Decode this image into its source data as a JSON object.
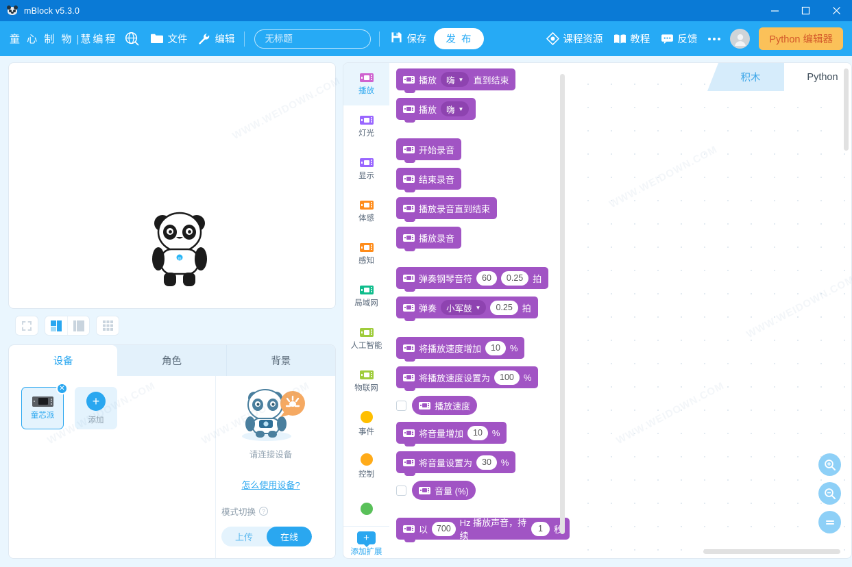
{
  "window": {
    "app_title": "mBlock v5.3.0",
    "minimize": "—",
    "maximize": "□",
    "close": "✕"
  },
  "menubar": {
    "brand": "童 心 制 物",
    "brand_sep": "|",
    "brand2": "慧编程",
    "globe_icon": "globe-icon",
    "file_label": "文件",
    "file_icon": "folder-icon",
    "edit_label": "编辑",
    "edit_icon": "wrench-icon",
    "project_name_value": "无标题",
    "project_name_placeholder": "无标题",
    "save_label": "保存",
    "save_icon": "floppy-disk-icon",
    "publish_label": "发 布",
    "courses_label": "课程资源",
    "courses_icon": "diamond-play-icon",
    "tutorial_label": "教程",
    "tutorial_icon": "book-icon",
    "feedback_label": "反馈",
    "feedback_icon": "chat-icon",
    "more_icon": "ellipsis-icon",
    "avatar_icon": "user-avatar-icon",
    "python_label": "Python 编辑器"
  },
  "stage": {
    "sprite_name": "panda-sprite",
    "tools": {
      "fullscreen_icon": "fullscreen-icon",
      "layout_small_icon": "layout-small-icon",
      "layout_large_icon": "layout-large-icon",
      "grid_icon": "grid-icon",
      "stop_icon": "stop-icon",
      "start_icon": "green-flag-icon"
    }
  },
  "bottom_panel": {
    "tabs": [
      {
        "label": "设备",
        "active": true
      },
      {
        "label": "角色",
        "active": false
      },
      {
        "label": "背景",
        "active": false
      }
    ],
    "device": {
      "name": "童芯派",
      "close_label": "✕",
      "add_label": "添加",
      "add_icon": "plus-icon"
    },
    "connection": {
      "status_text": "请连接设备",
      "help_link": "怎么使用设备?",
      "mode_label": "模式切换",
      "mode_help_icon": "question-mark-icon",
      "upload_label": "上传",
      "online_label": "在线",
      "active_mode": "在线"
    }
  },
  "categories": [
    {
      "label": "播放",
      "color": "#cf63cf",
      "shape": "block",
      "active": true
    },
    {
      "label": "灯光",
      "color": "#9966ff",
      "shape": "block",
      "active": false
    },
    {
      "label": "显示",
      "color": "#9966ff",
      "shape": "block",
      "active": false
    },
    {
      "label": "体感",
      "color": "#ff8c1a",
      "shape": "block",
      "active": false
    },
    {
      "label": "感知",
      "color": "#ff8c1a",
      "shape": "block",
      "active": false
    },
    {
      "label": "局域网",
      "color": "#0fbd8c",
      "shape": "block",
      "active": false
    },
    {
      "label": "人工智能",
      "color": "#9fcc3b",
      "shape": "block",
      "active": false
    },
    {
      "label": "物联网",
      "color": "#9fcc3b",
      "shape": "block",
      "active": false
    },
    {
      "label": "事件",
      "color": "#ffbf00",
      "shape": "dot",
      "active": false
    },
    {
      "label": "控制",
      "color": "#ffab19",
      "shape": "dot",
      "active": false
    },
    {
      "label": "",
      "color": "#59c059",
      "shape": "dot",
      "active": false
    }
  ],
  "category_add": {
    "label": "添加扩展",
    "icon": "plus-icon"
  },
  "palette": {
    "block_color": "#a154c4",
    "blocks": [
      {
        "type": "stack",
        "parts": [
          {
            "k": "icon",
            "v": "mblock-device-icon"
          },
          {
            "k": "text",
            "v": "播放"
          },
          {
            "k": "dropdown",
            "v": "嗨"
          },
          {
            "k": "text",
            "v": "直到结束"
          }
        ]
      },
      {
        "type": "stack",
        "parts": [
          {
            "k": "icon",
            "v": "mblock-device-icon"
          },
          {
            "k": "text",
            "v": "播放"
          },
          {
            "k": "dropdown",
            "v": "嗨"
          }
        ]
      },
      {
        "type": "gap"
      },
      {
        "type": "stack",
        "parts": [
          {
            "k": "icon",
            "v": "mblock-device-icon"
          },
          {
            "k": "text",
            "v": "开始录音"
          }
        ]
      },
      {
        "type": "stack",
        "parts": [
          {
            "k": "icon",
            "v": "mblock-device-icon"
          },
          {
            "k": "text",
            "v": "结束录音"
          }
        ]
      },
      {
        "type": "stack",
        "parts": [
          {
            "k": "icon",
            "v": "mblock-device-icon"
          },
          {
            "k": "text",
            "v": "播放录音直到结束"
          }
        ]
      },
      {
        "type": "stack",
        "parts": [
          {
            "k": "icon",
            "v": "mblock-device-icon"
          },
          {
            "k": "text",
            "v": "播放录音"
          }
        ]
      },
      {
        "type": "gap"
      },
      {
        "type": "stack",
        "parts": [
          {
            "k": "icon",
            "v": "mblock-device-icon"
          },
          {
            "k": "text",
            "v": "弹奏钢琴音符"
          },
          {
            "k": "num",
            "v": "60"
          },
          {
            "k": "num",
            "v": "0.25"
          },
          {
            "k": "text",
            "v": "拍"
          }
        ]
      },
      {
        "type": "stack",
        "parts": [
          {
            "k": "icon",
            "v": "mblock-device-icon"
          },
          {
            "k": "text",
            "v": "弹奏"
          },
          {
            "k": "dropdown",
            "v": "小军鼓"
          },
          {
            "k": "num",
            "v": "0.25"
          },
          {
            "k": "text",
            "v": "拍"
          }
        ]
      },
      {
        "type": "gap"
      },
      {
        "type": "stack",
        "parts": [
          {
            "k": "icon",
            "v": "mblock-device-icon"
          },
          {
            "k": "text",
            "v": "将播放速度增加"
          },
          {
            "k": "num",
            "v": "10"
          },
          {
            "k": "text",
            "v": "%"
          }
        ]
      },
      {
        "type": "stack",
        "parts": [
          {
            "k": "icon",
            "v": "mblock-device-icon"
          },
          {
            "k": "text",
            "v": "将播放速度设置为"
          },
          {
            "k": "num",
            "v": "100"
          },
          {
            "k": "text",
            "v": "%"
          }
        ]
      },
      {
        "type": "reporter",
        "checkbox": true,
        "parts": [
          {
            "k": "icon",
            "v": "mblock-device-icon"
          },
          {
            "k": "text",
            "v": "播放速度"
          }
        ]
      },
      {
        "type": "stack",
        "parts": [
          {
            "k": "icon",
            "v": "mblock-device-icon"
          },
          {
            "k": "text",
            "v": "将音量增加"
          },
          {
            "k": "num",
            "v": "10"
          },
          {
            "k": "text",
            "v": "%"
          }
        ]
      },
      {
        "type": "stack",
        "parts": [
          {
            "k": "icon",
            "v": "mblock-device-icon"
          },
          {
            "k": "text",
            "v": "将音量设置为"
          },
          {
            "k": "num",
            "v": "30"
          },
          {
            "k": "text",
            "v": "%"
          }
        ]
      },
      {
        "type": "reporter",
        "checkbox": true,
        "parts": [
          {
            "k": "icon",
            "v": "mblock-device-icon"
          },
          {
            "k": "text",
            "v": "音量 (%)"
          }
        ]
      },
      {
        "type": "gap"
      },
      {
        "type": "stack",
        "parts": [
          {
            "k": "icon",
            "v": "mblock-device-icon"
          },
          {
            "k": "text",
            "v": "以"
          },
          {
            "k": "num",
            "v": "700"
          },
          {
            "k": "text",
            "v": "Hz 播放声音，持续"
          },
          {
            "k": "num",
            "v": "1"
          },
          {
            "k": "text",
            "v": "秒"
          }
        ]
      }
    ]
  },
  "workspace": {
    "tabs": [
      {
        "label": "积木",
        "active": true
      },
      {
        "label": "Python",
        "active": false
      }
    ],
    "zoom_in_icon": "zoom-in-icon",
    "zoom_out_icon": "zoom-out-icon",
    "zoom_reset_icon": "zoom-reset-icon"
  },
  "watermarks": [
    "WWW.WEIDOWN.COM",
    "WWW.WEIDOWN.COM",
    "WWW.WEIDOWN.COM"
  ]
}
